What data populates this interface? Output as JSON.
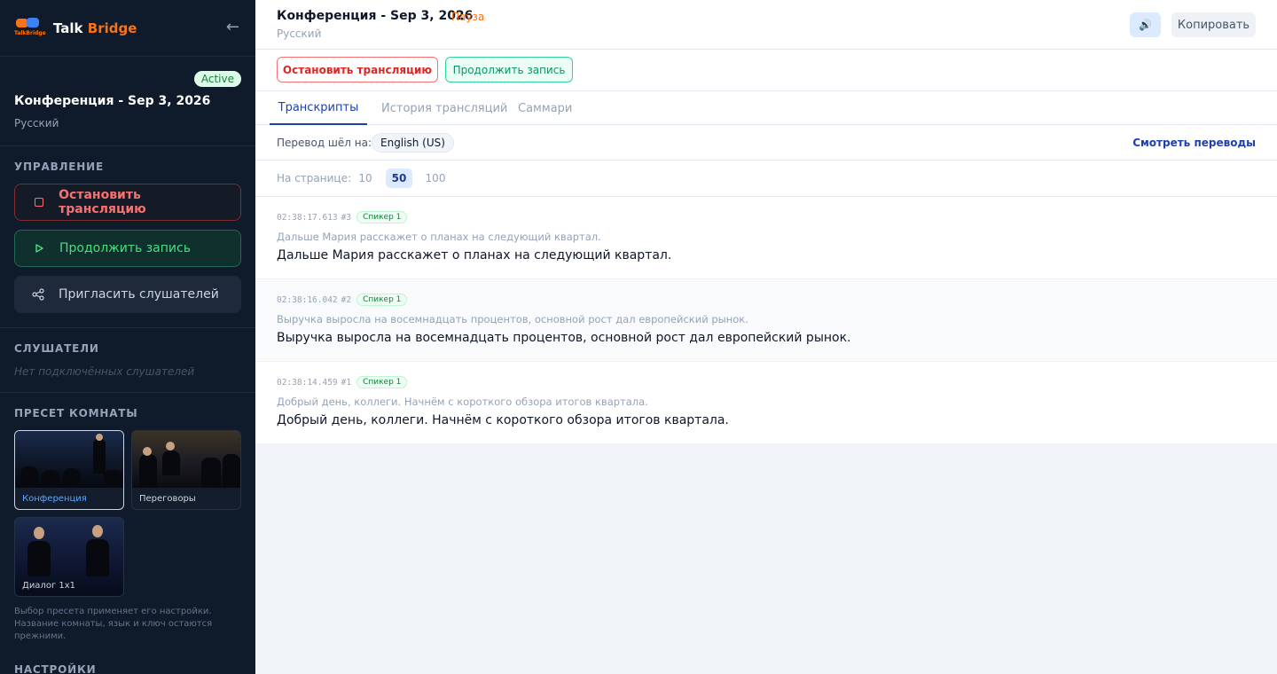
{
  "app": {
    "brand_first": "Talk",
    "brand_second": "Bridge",
    "logo_text": "TalkBridge"
  },
  "room": {
    "status": "Active",
    "title": "Конференция - Sep 3, 2026",
    "language": "Русский"
  },
  "sidebar": {
    "control_title": "УПРАВЛЕНИЕ",
    "stop_label": "Остановить трансляцию",
    "resume_label": "Продолжить запись",
    "invite_label": "Пригласить слушателей",
    "listeners_title": "СЛУШАТЕЛИ",
    "no_listeners": "Нет подключённых слушателей",
    "preset_title": "ПРЕСЕТ КОМНАТЫ",
    "presets": [
      {
        "label": "Конференция",
        "selected": true
      },
      {
        "label": "Переговоры",
        "selected": false
      },
      {
        "label": "Диалог 1x1",
        "selected": false
      }
    ],
    "preset_note": "Выбор пресета применяет его настройки. Название комнаты, язык и ключ остаются прежними.",
    "settings_title": "НАСТРОЙКИ"
  },
  "header": {
    "title": "Конференция - Sep 3, 2026",
    "status": "Пауза",
    "language": "Русский",
    "copy_label": "Копировать",
    "speaker_icon": "speaker-icon"
  },
  "actions": {
    "stop_label": "Остановить трансляцию",
    "resume_label": "Продолжить запись"
  },
  "tabs": [
    {
      "label": "Транскрипты",
      "active": true
    },
    {
      "label": "История трансляций",
      "active": false
    },
    {
      "label": "Саммари",
      "active": false
    }
  ],
  "translation": {
    "label": "Перевод шёл на:",
    "language": "English (US)",
    "view_link": "Смотреть переводы"
  },
  "pagination": {
    "label": "На странице:",
    "options": [
      "10",
      "50",
      "100"
    ],
    "selected": "50"
  },
  "entries": [
    {
      "time": "02:38:17.613",
      "num": "#3",
      "speaker": "Спикер 1",
      "original": "Дальше Мария расскажет о планах на следующий квартал.",
      "text": "Дальше Мария расскажет о планах на следующий квартал."
    },
    {
      "time": "02:38:16.042",
      "num": "#2",
      "speaker": "Спикер 1",
      "original": "Выручка выросла на восемнадцать процентов, основной рост дал европейский рынок.",
      "text": "Выручка выросла на восемнадцать процентов, основной рост дал европейский рынок."
    },
    {
      "time": "02:38:14.459",
      "num": "#1",
      "speaker": "Спикер 1",
      "original": "Добрый день, коллеги. Начнём с короткого обзора итогов квартала.",
      "text": "Добрый день, коллеги. Начнём с короткого обзора итогов квартала."
    }
  ],
  "colors": {
    "sidebar_bg": "#0f1b2b",
    "accent_orange": "#f97316",
    "accent_blue": "#1e40af",
    "danger": "#dc2626",
    "success": "#059669"
  }
}
